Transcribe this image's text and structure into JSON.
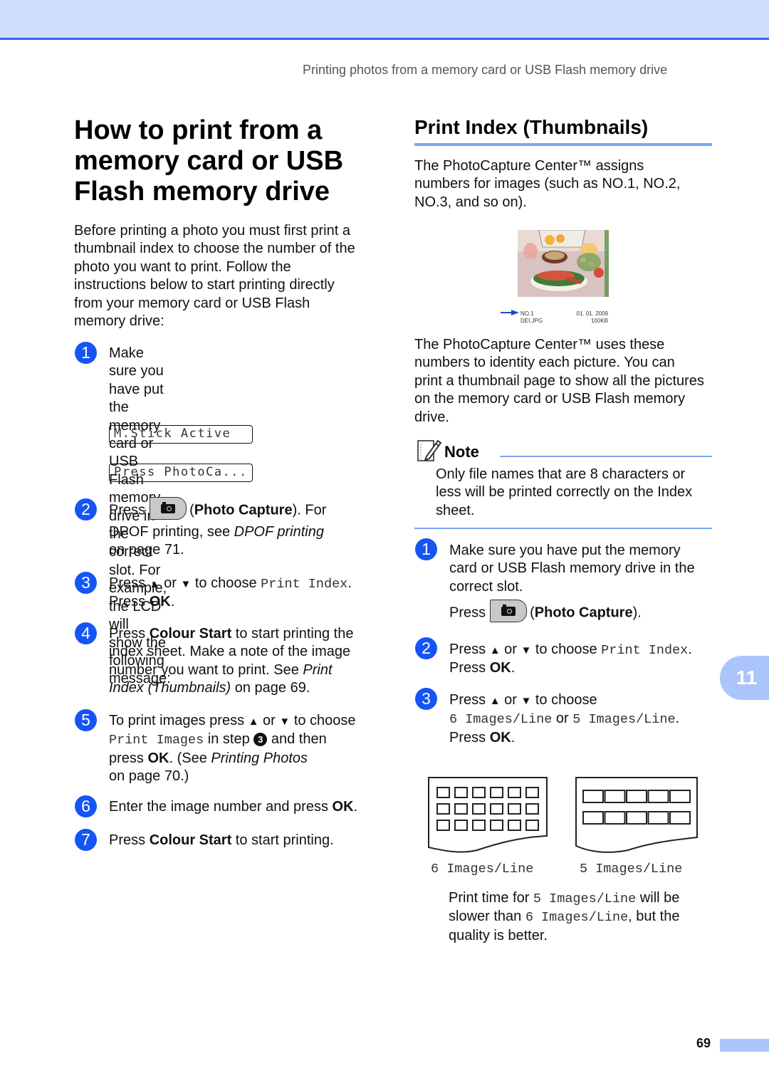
{
  "header": {
    "running_title": "Printing photos from a memory card or USB Flash memory drive"
  },
  "left": {
    "title_lines": [
      "How to print from a",
      "memory card or USB",
      "Flash memory drive"
    ],
    "intro_lines": [
      "Before printing a photo you must first print a",
      "thumbnail index to choose the number of the",
      "photo you want to print. Follow the",
      "instructions below to start printing directly",
      "from your memory card or USB Flash",
      "memory drive:"
    ],
    "steps": [
      {
        "num": "1",
        "lines": [
          "Make sure you have put the memory",
          "card or USB Flash memory drive in the",
          "correct slot. For example, the LCD will",
          "show the following message:"
        ],
        "lcd": [
          "M.Stick Active",
          "Press PhotoCa..."
        ]
      },
      {
        "num": "2",
        "press": "Press",
        "button_name": "Photo Capture",
        "after": "). For",
        "line2_pre": "DPOF printing, see ",
        "line2_link": "DPOF printing",
        "line3": "on page 71."
      },
      {
        "num": "3",
        "pre": "Press ",
        "up": "▲",
        "or": " or ",
        "down": "▼",
        "mid": " to choose ",
        "mono": "Print Index",
        "end": ".",
        "line2_pre": "Press ",
        "line2_bold": "OK",
        "line2_end": "."
      },
      {
        "num": "4",
        "pre": "Press ",
        "bold": "Colour Start",
        "post": " to start printing the",
        "line2": "index sheet. Make a note of the image",
        "line3_pre": "number you want to print. See ",
        "line3_link": "Print",
        "line4_link": "Index (Thumbnails)",
        "line4_post": " on page 69."
      },
      {
        "num": "5",
        "pre": "To print images press ",
        "up": "▲",
        "or": " or ",
        "down": "▼",
        "post": " to choose",
        "line2_mono": "Print Images",
        "line2_mid": " in step ",
        "line2_ref": "3",
        "line2_post": " and then",
        "line3_pre": "press ",
        "line3_bold": "OK",
        "line3_mid": ". (See ",
        "line3_link": "Printing Photos",
        "line4": "on page 70.)"
      },
      {
        "num": "6",
        "pre": "Enter the image number and press ",
        "bold": "OK",
        "end": "."
      },
      {
        "num": "7",
        "pre": "Press ",
        "bold": "Colour Start",
        "post": " to start printing."
      }
    ]
  },
  "right": {
    "section_title": "Print Index (Thumbnails)",
    "para1_lines": [
      "The PhotoCapture Center™ assigns",
      "numbers for images (such as NO.1, NO.2,",
      "NO.3, and so on)."
    ],
    "thumbnail": {
      "number": "NO.1",
      "filename": "DEI.JPG",
      "date": "01. 01. 2009",
      "size": "100KB"
    },
    "para2_lines": [
      "The PhotoCapture Center™ uses these",
      "numbers to identity each picture. You can",
      "print a thumbnail page to show all the pictures",
      "on the memory card or USB Flash memory",
      "drive."
    ],
    "note": {
      "title": "Note",
      "lines": [
        "Only file names that are 8 characters or",
        "less will be printed correctly on the Index",
        "sheet."
      ]
    },
    "steps": [
      {
        "num": "1",
        "lines": [
          "Make sure you have put the memory",
          "card or USB Flash memory drive in the",
          "correct slot."
        ],
        "press": "Press",
        "button_name": "Photo Capture",
        "after": ")."
      },
      {
        "num": "2",
        "pre": "Press ",
        "up": "▲",
        "or": " or ",
        "down": "▼",
        "mid": " to choose ",
        "mono": "Print Index",
        "end": ".",
        "line2_pre": "Press ",
        "line2_bold": "OK",
        "line2_end": "."
      },
      {
        "num": "3",
        "pre": "Press ",
        "up": "▲",
        "or": " or ",
        "down": "▼",
        "post": " to choose",
        "line2_mono_a": "6 Images/Line",
        "line2_or": " or ",
        "line2_mono_b": "5 Images/Line",
        "line2_end": ".",
        "line3_pre": "Press ",
        "line3_bold": "OK",
        "line3_end": "."
      }
    ],
    "sheets": [
      {
        "label": "6 Images/Line",
        "rows": 3,
        "cols": 6
      },
      {
        "label": "5 Images/Line",
        "rows": 2,
        "cols": 5
      }
    ],
    "print_time": {
      "pre": "Print time for ",
      "mono_a": "5 Images/Line",
      "mid": " will be",
      "line2_pre": "slower than ",
      "mono_b": "6 Images/Line",
      "line2_post": ", but the",
      "line3": "quality is better."
    }
  },
  "chapter_tab": "11",
  "page_number": "69",
  "colors": {
    "accent_blue": "#1554f5",
    "rule_blue": "#7da3f3",
    "band_blue": "#cfddfc",
    "tab_blue": "#abc4fa"
  }
}
